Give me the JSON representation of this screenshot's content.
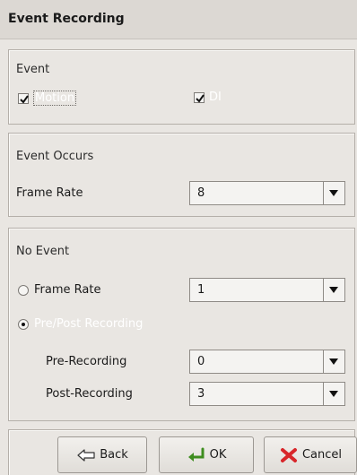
{
  "title": "Event Recording",
  "event": {
    "heading": "Event",
    "motion": {
      "label": "Motion",
      "checked": true
    },
    "di": {
      "label": "DI",
      "checked": true
    }
  },
  "event_occurs": {
    "heading": "Event Occurs",
    "frame_rate_label": "Frame Rate",
    "frame_rate_value": "8"
  },
  "no_event": {
    "heading": "No Event",
    "frame_rate_label": "Frame Rate",
    "frame_rate_value": "1",
    "frame_rate_selected": false,
    "prepost_label": "Pre/Post Recording",
    "prepost_selected": true,
    "pre_label": "Pre-Recording",
    "pre_value": "0",
    "post_label": "Post-Recording",
    "post_value": "3"
  },
  "buttons": {
    "back": "Back",
    "ok": "OK",
    "cancel": "Cancel"
  },
  "colors": {
    "background": "#e9e6e2",
    "title_bar": "#dcd8d3",
    "selected_text": "#ffffff",
    "cancel_red": "#d8262a",
    "ok_green": "#3e8d1f"
  }
}
